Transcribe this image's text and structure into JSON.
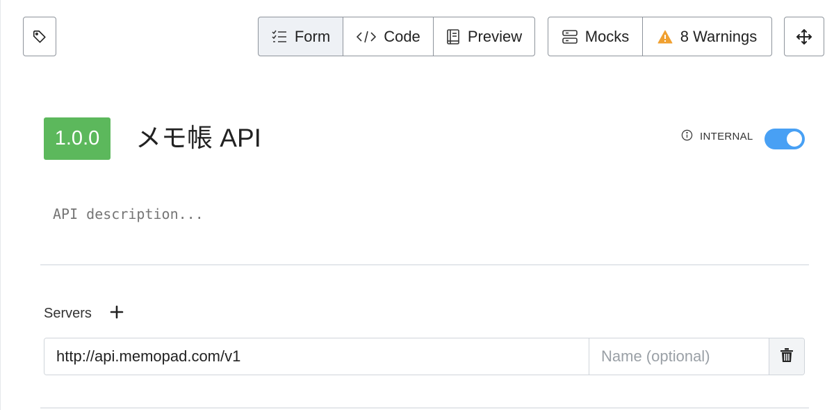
{
  "toolbar": {
    "tag_icon": "tag-icon",
    "view_tabs": [
      {
        "label": "Form",
        "icon": "list-check-icon",
        "active": true
      },
      {
        "label": "Code",
        "icon": "code-icon",
        "active": false
      },
      {
        "label": "Preview",
        "icon": "book-icon",
        "active": false
      }
    ],
    "mocks_label": "Mocks",
    "mocks_icon": "server-icon",
    "warnings_label": "8 Warnings",
    "warnings_icon": "warning-icon",
    "move_icon": "move-icon"
  },
  "api": {
    "version": "1.0.0",
    "title": "メモ帳 API",
    "internal_label": "INTERNAL",
    "internal_enabled": true,
    "description_placeholder": "API description..."
  },
  "servers": {
    "label": "Servers",
    "items": [
      {
        "url": "http://api.memopad.com/v1",
        "name_placeholder": "Name (optional)",
        "name": ""
      }
    ]
  },
  "colors": {
    "version_badge": "#5cb85c",
    "toggle_on": "#48a0f4",
    "warning": "#f0a030",
    "active_tab_bg": "#eef1f5"
  }
}
